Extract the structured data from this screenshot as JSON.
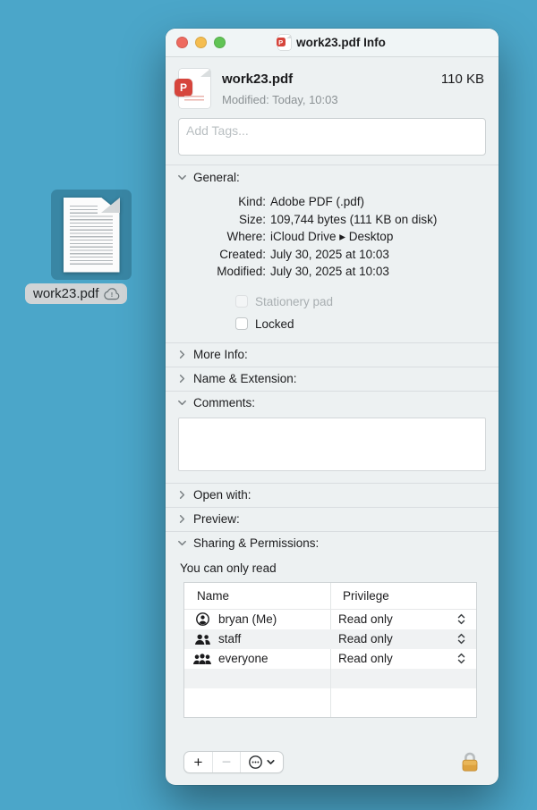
{
  "colors": {
    "desktop_bg": "#4BA6C9",
    "window_bg": "#EDF1F2",
    "traffic_red": "#EE6A5F",
    "traffic_yellow": "#F5BD4F",
    "traffic_green": "#61C455",
    "pdf_red": "#D6453C",
    "lock_gold": "#DDA23F"
  },
  "desktop": {
    "file_label": "work23.pdf"
  },
  "titlebar": {
    "title": "work23.pdf Info",
    "pdf_badge_letter": "P"
  },
  "header": {
    "filename": "work23.pdf",
    "size": "110 KB",
    "modified": "Modified: Today, 10:03"
  },
  "tags": {
    "placeholder": "Add Tags..."
  },
  "general": {
    "label": "General:",
    "rows": [
      {
        "label": "Kind:",
        "value": "Adobe PDF (.pdf)"
      },
      {
        "label": "Size:",
        "value": "109,744 bytes (111 KB on disk)"
      },
      {
        "label": "Where:",
        "value": "iCloud Drive ▸ Desktop"
      },
      {
        "label": "Created:",
        "value": "July 30, 2025 at 10:03"
      },
      {
        "label": "Modified:",
        "value": "July 30, 2025 at 10:03"
      }
    ],
    "checkboxes": [
      {
        "label": "Stationery pad",
        "checked": false,
        "disabled": true
      },
      {
        "label": "Locked",
        "checked": false,
        "disabled": false
      }
    ]
  },
  "sections": {
    "more_info": "More Info:",
    "name_extension": "Name & Extension:",
    "comments": "Comments:",
    "open_with": "Open with:",
    "preview": "Preview:",
    "sharing": "Sharing & Permissions:"
  },
  "sharing": {
    "note": "You can only read",
    "table": {
      "columns": [
        "Name",
        "Privilege"
      ],
      "rows": [
        {
          "icon": "user-circle-icon",
          "name": "bryan (Me)",
          "privilege": "Read only"
        },
        {
          "icon": "users-two-icon",
          "name": "staff",
          "privilege": "Read only"
        },
        {
          "icon": "users-three-icon",
          "name": "everyone",
          "privilege": "Read only"
        }
      ]
    },
    "controls": {
      "add": "+",
      "remove": "−"
    }
  }
}
